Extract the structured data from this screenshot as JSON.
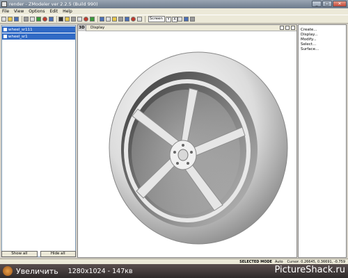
{
  "window": {
    "title": "render - ZModeler ver 2.2.5 (Build 990)",
    "minimize": "_",
    "maximize": "□",
    "close": "✕"
  },
  "menu": [
    "File",
    "View",
    "Options",
    "Edit",
    "Help"
  ],
  "toolbar": {
    "icons": [
      "new-icon",
      "open-icon",
      "save-icon",
      "undo-icon",
      "select-icon",
      "move-icon",
      "rotate-icon",
      "scale-icon",
      "render-icon",
      "light-icon",
      "camera-icon",
      "grid-icon"
    ],
    "screen_label": "Screen",
    "letters": [
      "Y",
      "X"
    ]
  },
  "objects": [
    {
      "name": "wheel_sr111",
      "checked": true
    },
    {
      "name": "wheel_sr1",
      "checked": true
    }
  ],
  "left_buttons": {
    "show_all": "Show all",
    "hide_all": "Hide all"
  },
  "viewport": {
    "mode_label": "3D",
    "display_label": "Display"
  },
  "commands": [
    "Create...",
    "Display...",
    "Modify...",
    "Select...",
    "Surface..."
  ],
  "status": {
    "mode": "SELECTED MODE",
    "auto": "Auto",
    "cursor": "Cursor: 0.26645, 0.36691, -0.759"
  },
  "overlay": {
    "text": "Увеличить",
    "resolution": "1280x1024 - 147кв",
    "brand": "PictureShack.ru"
  }
}
